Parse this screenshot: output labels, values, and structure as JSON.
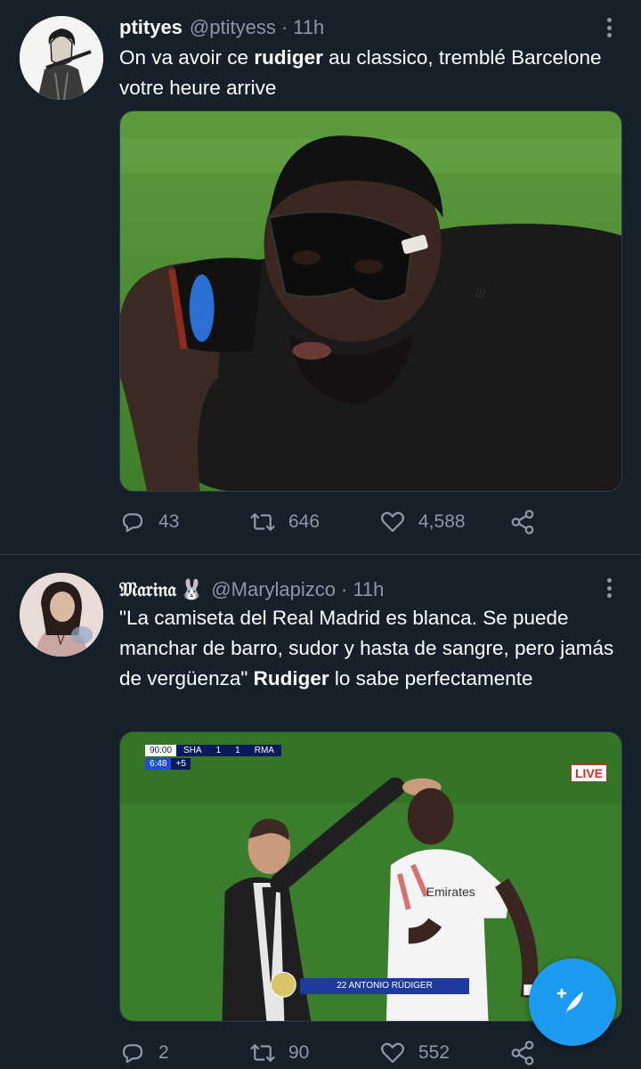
{
  "tweets": [
    {
      "display_name": "ptityes",
      "handle": "@ptityess",
      "separator": "·",
      "time": "11h",
      "text_parts": [
        "On va avoir ce ",
        "rudiger",
        " au classico, tremblé Barcelone votre heure arrive"
      ],
      "image_alt": "Player wearing a black protective face mask",
      "stats": {
        "replies": "43",
        "retweets": "646",
        "likes": "4,588"
      }
    },
    {
      "display_name": "𝔐𝔞𝔯𝔦𝔫𝔞",
      "name_emoji": "🐰",
      "handle": "@Marylapizco",
      "separator": "·",
      "time": "11h",
      "text_parts": [
        "\"La camiseta del Real Madrid es blanca. Se puede manchar de barro, sudor y hasta de sangre, pero jamás de vergüenza\" ",
        "Rudiger",
        " lo sabe perfectamente"
      ],
      "image_alt": "Broadcast still of coach touching player's head",
      "broadcast": {
        "clock": "90:00",
        "home": "SHA",
        "home_score": "1",
        "away_score": "1",
        "away": "RMA",
        "added_clock": "6:48",
        "added_time": "+5",
        "live": "LIVE",
        "lower_third": "22 ANTONIO RÜDIGER"
      },
      "stats": {
        "replies": "2",
        "retweets": "90",
        "likes": "552"
      }
    }
  ],
  "icons": [
    "reply-icon",
    "retweet-icon",
    "like-icon",
    "share-icon",
    "more-icon",
    "compose-icon"
  ],
  "colors": {
    "background": "#15202b",
    "muted": "#8b98a5",
    "accent": "#1d9bf0",
    "divider": "#38444d"
  }
}
